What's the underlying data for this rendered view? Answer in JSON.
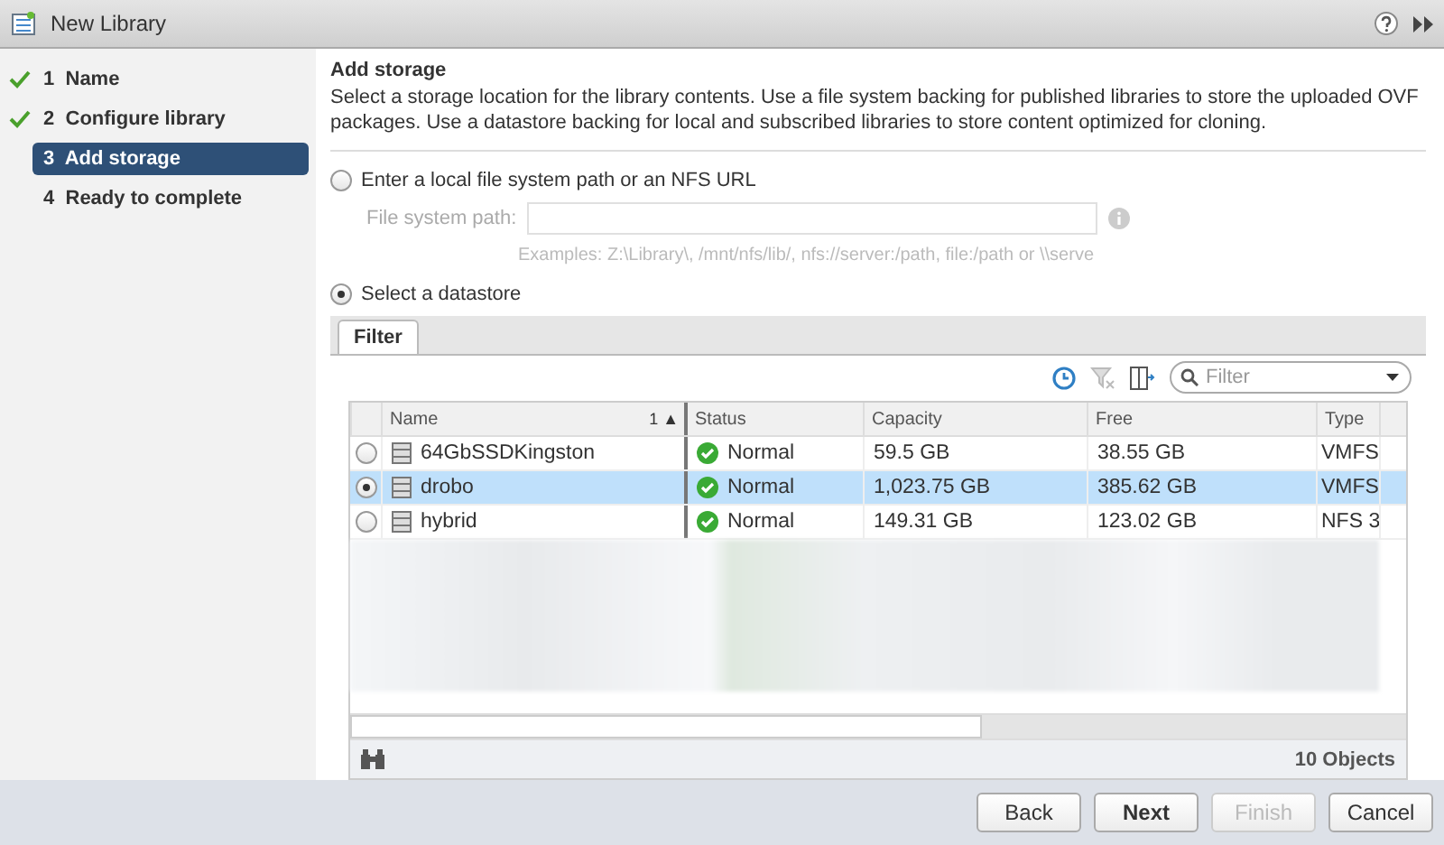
{
  "window": {
    "title": "New Library"
  },
  "steps": [
    {
      "number": "1",
      "label": "Name",
      "completed": true,
      "selected": false
    },
    {
      "number": "2",
      "label": "Configure library",
      "completed": true,
      "selected": false
    },
    {
      "number": "3",
      "label": "Add storage",
      "completed": false,
      "selected": true
    },
    {
      "number": "4",
      "label": "Ready to complete",
      "completed": false,
      "selected": false
    }
  ],
  "section": {
    "title": "Add storage",
    "description": "Select a storage location for the library contents. Use a file system backing for published libraries to store the uploaded OVF packages. Use a datastore backing for local and subscribed libraries to store content optimized for cloning."
  },
  "options": [
    {
      "label": "Enter a local file system path or an NFS URL",
      "selected": false
    },
    {
      "label": "Select a datastore",
      "selected": true
    }
  ],
  "path_field": {
    "label": "File system path:",
    "hint": "Examples: Z:\\Library\\, /mnt/nfs/lib/, nfs://server:/path, file:/path or \\\\serve"
  },
  "tabs": [
    {
      "label": "Filter",
      "selected": true
    }
  ],
  "filter": {
    "placeholder": "Filter"
  },
  "table": {
    "columns": [
      {
        "label": "Name",
        "sort": "1 ▲"
      },
      {
        "label": "Status"
      },
      {
        "label": "Capacity"
      },
      {
        "label": "Free"
      },
      {
        "label": "Type"
      }
    ],
    "rows": [
      {
        "name": "64GbSSDKingston",
        "status": "Normal",
        "capacity": "59.5  GB",
        "free": "38.55  GB",
        "type": "VMFS",
        "selected": false
      },
      {
        "name": "drobo",
        "status": "Normal",
        "capacity": "1,023.75  GB",
        "free": "385.62  GB",
        "type": "VMFS",
        "selected": true
      },
      {
        "name": "hybrid",
        "status": "Normal",
        "capacity": "149.31  GB",
        "free": "123.02  GB",
        "type": "NFS 3",
        "selected": false
      }
    ],
    "count": "10 Objects"
  },
  "buttons": [
    {
      "label": "Back",
      "primary": false,
      "disabled": false
    },
    {
      "label": "Next",
      "primary": true,
      "disabled": false
    },
    {
      "label": "Finish",
      "primary": false,
      "disabled": true
    },
    {
      "label": "Cancel",
      "primary": false,
      "disabled": false
    }
  ]
}
